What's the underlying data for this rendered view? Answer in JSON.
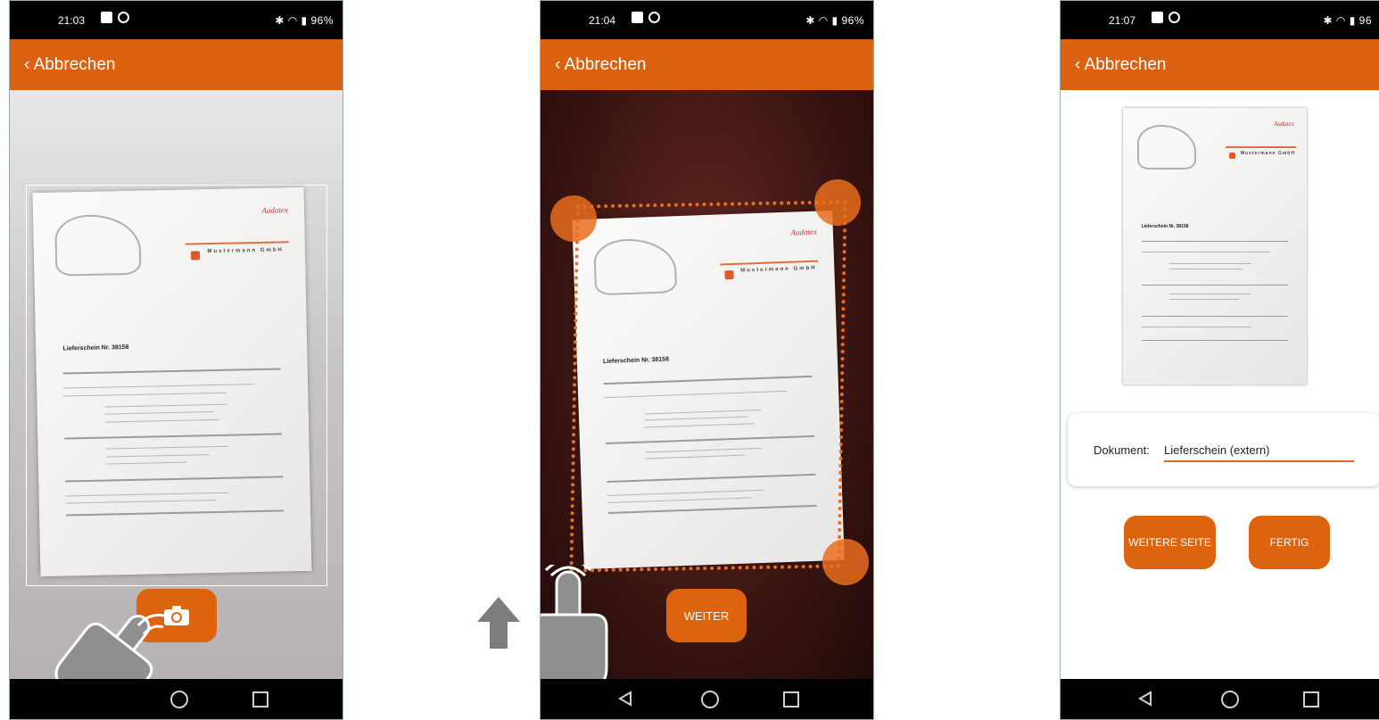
{
  "screens": [
    {
      "time": "21:03",
      "battery": "96%",
      "back_label": "Abbrechen",
      "doc_title": "Lieferschein Nr. 38158",
      "doc_brand": "Audatex",
      "doc_company": "Mustermann GmbH"
    },
    {
      "time": "21:04",
      "battery": "96%",
      "back_label": "Abbrechen",
      "doc_title": "Lieferschein Nr. 38158",
      "doc_brand": "Audatex",
      "doc_company": "Mustermann GmbH",
      "next_label": "WEITER"
    },
    {
      "time": "21:07",
      "battery": "96",
      "back_label": "Abbrechen",
      "doc_brand": "Audatex",
      "doc_company": "Mustermann GmbH",
      "doc_title": "Lieferschein Nr. 38158",
      "document_label": "Dokument:",
      "document_value": "Lieferschein (extern)",
      "more_page_label": "WEITERE SEITE",
      "done_label": "FERTIG"
    }
  ],
  "colors": {
    "accent": "#d9610f",
    "button": "#dd640f"
  },
  "icons": [
    "camera-icon",
    "hand-tap-icon",
    "arrow-up-icon",
    "back-icon",
    "home-icon",
    "recents-icon"
  ]
}
